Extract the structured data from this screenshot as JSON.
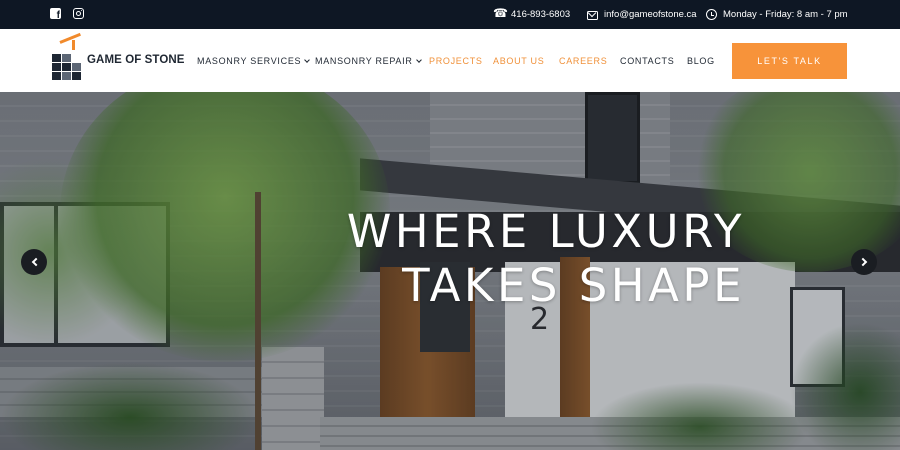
{
  "topbar": {
    "social": [
      {
        "icon": "facebook-icon"
      },
      {
        "icon": "instagram-icon"
      }
    ],
    "phone": "416-893-6803",
    "email": "info@gameofstone.ca",
    "hours": "Monday - Friday: 8 am - 7 pm"
  },
  "header": {
    "logo_text": "GAME OF STONE",
    "nav": [
      {
        "label": "MASONRY SERVICES",
        "dropdown": true
      },
      {
        "label": "MANSONRY REPAIR",
        "dropdown": true
      },
      {
        "label": "PROJECTS",
        "dropdown": false
      },
      {
        "label": "ABOUT US",
        "dropdown": false
      },
      {
        "label": "CAREERS",
        "dropdown": false
      },
      {
        "label": "CONTACTS",
        "dropdown": false
      },
      {
        "label": "BLOG",
        "dropdown": false
      }
    ],
    "cta_label": "LET'S TALK"
  },
  "hero": {
    "title_line1": "WHERE LUXURY",
    "title_line2": "TAKES SHAPE",
    "house_number": "2"
  },
  "colors": {
    "accent": "#f7933a",
    "topbar_bg": "#0e1724",
    "text_dark": "#1f2732"
  }
}
